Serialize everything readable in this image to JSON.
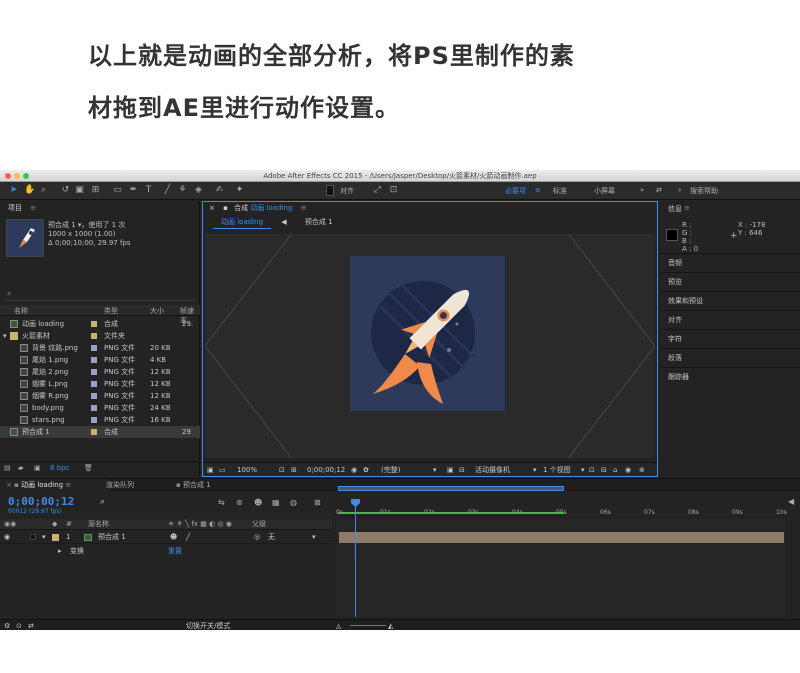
{
  "headline": {
    "line1": "以上就是动画的全部分析，将PS里制作的素",
    "line2": "材拖到AE里进行动作设置。"
  },
  "window": {
    "title": "Adobe After Effects CC 2015 - /Users/Jasper/Desktop/火箭素材/火箭动画制作.aep"
  },
  "toolbar": {
    "align_label": "对齐",
    "workspaces": [
      "必要项",
      "标准",
      "小屏幕"
    ],
    "search_help": "搜索帮助"
  },
  "project": {
    "panel_title": "项目",
    "selected_name": "预合成 1 ▾，使用了 1 次",
    "selected_size": "1000 x 1000 (1.00)",
    "selected_duration": "Δ 0;00;10;00, 29.97 fps",
    "columns": [
      "名称",
      "类型",
      "大小",
      "帧速率"
    ],
    "items": [
      {
        "name": "动画 loading",
        "type": "合成",
        "size": "",
        "fps": "29.",
        "indent": 0,
        "kind": "comp",
        "color": "#c8b46e"
      },
      {
        "name": "火箭素材",
        "type": "文件夹",
        "size": "",
        "fps": "",
        "indent": 0,
        "kind": "folder",
        "color": "#c8b46e"
      },
      {
        "name": "背景 纹路.png",
        "type": "PNG 文件",
        "size": "20 KB",
        "fps": "",
        "indent": 1,
        "kind": "file",
        "color": "#9aa0c8"
      },
      {
        "name": "尾焰 1.png",
        "type": "PNG 文件",
        "size": "4 KB",
        "fps": "",
        "indent": 1,
        "kind": "file",
        "color": "#9aa0c8"
      },
      {
        "name": "尾焰 2.png",
        "type": "PNG 文件",
        "size": "12 KB",
        "fps": "",
        "indent": 1,
        "kind": "file",
        "color": "#9aa0c8"
      },
      {
        "name": "烟雾 L.png",
        "type": "PNG 文件",
        "size": "12 KB",
        "fps": "",
        "indent": 1,
        "kind": "file",
        "color": "#9aa0c8"
      },
      {
        "name": "烟雾 R.png",
        "type": "PNG 文件",
        "size": "12 KB",
        "fps": "",
        "indent": 1,
        "kind": "file",
        "color": "#9aa0c8"
      },
      {
        "name": "body.png",
        "type": "PNG 文件",
        "size": "24 KB",
        "fps": "",
        "indent": 1,
        "kind": "file",
        "color": "#9aa0c8"
      },
      {
        "name": "stars.png",
        "type": "PNG 文件",
        "size": "16 KB",
        "fps": "",
        "indent": 1,
        "kind": "file",
        "color": "#9aa0c8"
      },
      {
        "name": "预合成 1",
        "type": "合成",
        "size": "",
        "fps": "29",
        "indent": 0,
        "kind": "comp",
        "color": "#c8b46e"
      }
    ],
    "bpc": "8 bpc"
  },
  "viewer": {
    "tab_prefix": "合成",
    "tab_name": "动画 loading",
    "subtabs": [
      "动画 loading",
      "预合成 1"
    ],
    "zoom": "100%",
    "timecode": "0;00;00;12",
    "resolution": "(完整)",
    "camera": "活动摄像机",
    "views": "1 个视图"
  },
  "info": {
    "title": "信息",
    "r": "R :",
    "g": "G :",
    "b": "B :",
    "a": "A : 0",
    "x": "X : -178",
    "y": "Y : 646",
    "sections": [
      "音频",
      "预览",
      "效果和预设",
      "对齐",
      "字符",
      "段落",
      "跟踪器"
    ]
  },
  "timeline": {
    "tabs": [
      "动画 loading",
      "渲染队列",
      "预合成 1"
    ],
    "timecode": "0;00;00;12",
    "fps": "00012 (29.97 fps)",
    "col_source": "源名称",
    "col_parent": "父级",
    "layer_num": "1",
    "layer_name": "预合成 1",
    "parent_value": "无",
    "transform": "变换",
    "reset": "重置",
    "ruler": [
      "0s",
      "01s",
      "02s",
      "03s",
      "04s",
      "05s",
      "06s",
      "07s",
      "08s",
      "09s",
      "10s"
    ],
    "toggle_label": "切换开关/模式"
  },
  "colors": {
    "accent": "#3b8ee8",
    "comp_bg": "#2e3a5c",
    "rocket_orange": "#f08a4b"
  }
}
